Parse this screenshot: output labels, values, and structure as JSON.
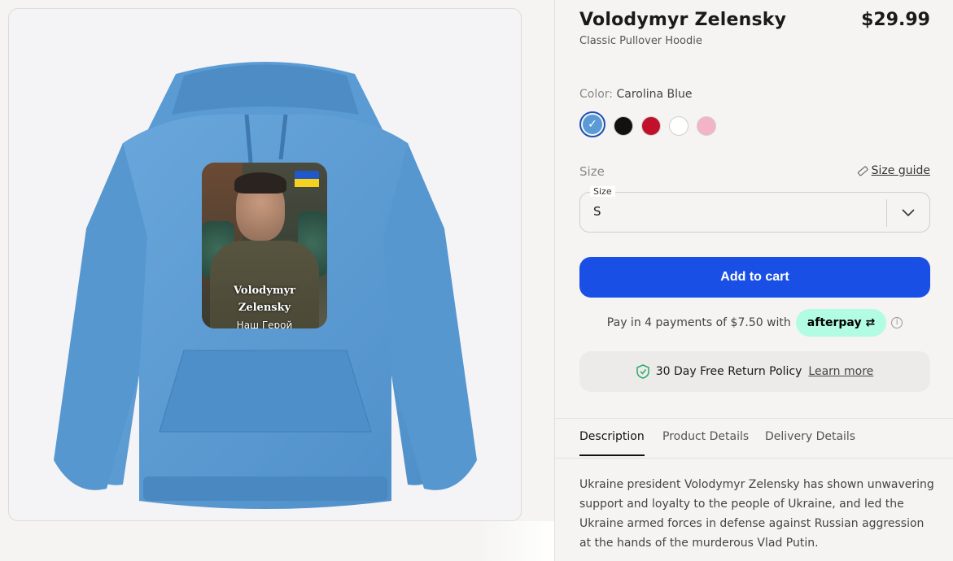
{
  "product": {
    "title": "Volodymyr Zelensky",
    "price": "$29.99",
    "subtitle": "Classic Pullover Hoodie"
  },
  "print": {
    "name_line1": "Volodymyr",
    "name_line2": "Zelensky",
    "caption": "Наш Герой"
  },
  "color": {
    "label": "Color:",
    "selected": "Carolina Blue",
    "swatches": [
      {
        "name": "Carolina Blue",
        "hex": "#5b9bd5"
      },
      {
        "name": "Black",
        "hex": "#111111"
      },
      {
        "name": "Red",
        "hex": "#c2102a"
      },
      {
        "name": "White",
        "hex": "#ffffff"
      },
      {
        "name": "Pink",
        "hex": "#f3b3c9"
      }
    ]
  },
  "size": {
    "label": "Size",
    "guide_label": "Size guide",
    "floating_label": "Size",
    "value": "S"
  },
  "cart": {
    "add_label": "Add to cart"
  },
  "payment": {
    "text": "Pay in 4 payments of $7.50 with",
    "provider": "afterpay"
  },
  "returns": {
    "text": "30 Day Free Return Policy",
    "link": "Learn more"
  },
  "tabs": [
    {
      "label": "Description"
    },
    {
      "label": "Product Details"
    },
    {
      "label": "Delivery Details"
    }
  ],
  "description": "Ukraine president Volodymyr Zelensky has shown unwavering support and loyalty to the people of Ukraine, and led the Ukraine armed forces in defense against Russian aggression at the hands of the murderous Vlad Putin.",
  "colors": {
    "accent": "#1a4fe6",
    "hoodie": "#5b9bd5",
    "afterpay": "#b2fce4"
  }
}
